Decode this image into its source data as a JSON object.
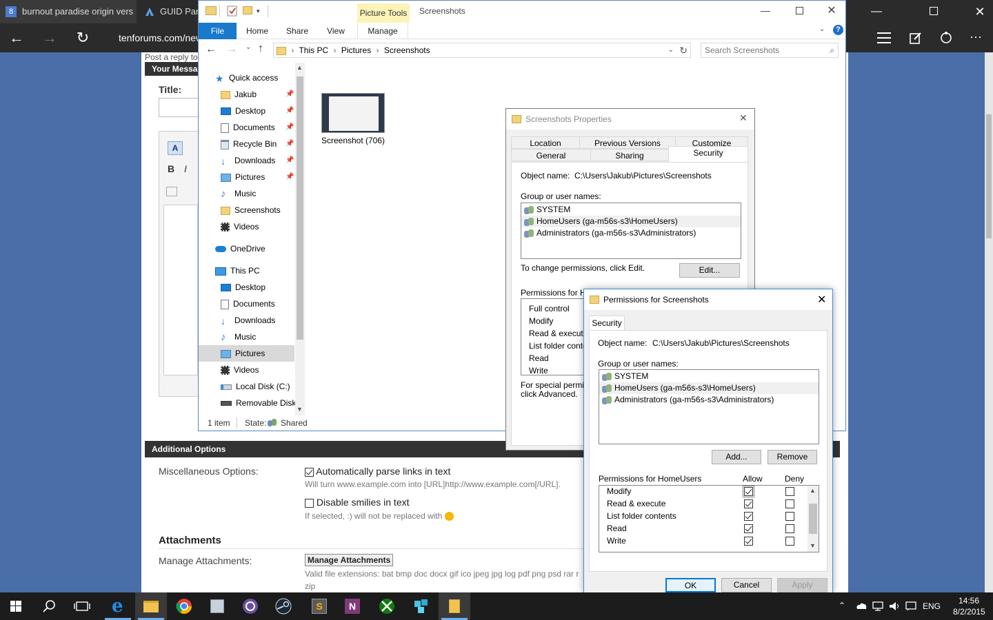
{
  "edge": {
    "tabs": [
      {
        "title": "burnout paradise origin vers"
      },
      {
        "title": "GUID Part"
      }
    ],
    "address": "tenforums.com/new"
  },
  "webpage": {
    "post_reply": "Post a reply to",
    "your_message": "Your Messag",
    "title_label": "Title:",
    "additional_options": "Additional Options",
    "misc_options_label": "Miscellaneous Options:",
    "auto_parse_label": "Automatically parse links in text",
    "auto_parse_hint": "Will turn www.example.com into [URL]http://www.example.com[/URL].",
    "disable_smilies_label": "Disable smilies in text",
    "disable_smilies_hint": "If selected, :) will not be replaced with",
    "attachments_heading": "Attachments",
    "manage_attachments_label": "Manage Attachments:",
    "manage_attachments_button": "Manage Attachments",
    "valid_extensions": "Valid file extensions: bat bmp doc docx gif ico jpeg jpg log pdf png psd rar r",
    "valid_extensions_tail": "zip"
  },
  "explorer": {
    "context_tab": "Picture Tools",
    "window_title": "Screenshots",
    "ribbon_tabs": [
      "File",
      "Home",
      "Share",
      "View",
      "Manage"
    ],
    "breadcrumb": [
      "This PC",
      "Pictures",
      "Screenshots"
    ],
    "search_placeholder": "Search Screenshots",
    "nav": [
      {
        "label": "Quick access",
        "icon": "star-icon",
        "pinned": false
      },
      {
        "label": "Jakub",
        "icon": "folder-icon",
        "pinned": true
      },
      {
        "label": "Desktop",
        "icon": "desktop-icon",
        "pinned": true
      },
      {
        "label": "Documents",
        "icon": "documents-icon",
        "pinned": true
      },
      {
        "label": "Recycle Bin",
        "icon": "recycle-bin-icon",
        "pinned": true
      },
      {
        "label": "Downloads",
        "icon": "downloads-icon",
        "pinned": true
      },
      {
        "label": "Pictures",
        "icon": "pictures-icon",
        "pinned": true
      },
      {
        "label": "Music",
        "icon": "music-icon",
        "pinned": false
      },
      {
        "label": "Screenshots",
        "icon": "folder-icon",
        "pinned": false
      },
      {
        "label": "Videos",
        "icon": "videos-icon",
        "pinned": false
      },
      {
        "label": "OneDrive",
        "icon": "onedrive-icon",
        "pinned": false
      },
      {
        "label": "This PC",
        "icon": "computer-icon",
        "pinned": false
      },
      {
        "label": "Desktop",
        "icon": "desktop-icon",
        "pinned": false
      },
      {
        "label": "Documents",
        "icon": "documents-icon",
        "pinned": false
      },
      {
        "label": "Downloads",
        "icon": "downloads-icon",
        "pinned": false
      },
      {
        "label": "Music",
        "icon": "music-icon",
        "pinned": false
      },
      {
        "label": "Pictures",
        "icon": "pictures-icon",
        "pinned": false
      },
      {
        "label": "Videos",
        "icon": "videos-icon",
        "pinned": false
      },
      {
        "label": "Local Disk (C:)",
        "icon": "local-disk-icon",
        "pinned": false
      },
      {
        "label": "Removable Disk",
        "icon": "removable-disk-icon",
        "pinned": false
      }
    ],
    "file": {
      "name": "Screenshot (706)"
    },
    "status_count": "1 item",
    "status_state_label": "State:",
    "status_state_value": "Shared"
  },
  "properties": {
    "title": "Screenshots Properties",
    "tabs_row1": [
      "Location",
      "Previous Versions",
      "Customize"
    ],
    "tabs_row2": [
      "General",
      "Sharing",
      "Security"
    ],
    "object_name_label": "Object name:",
    "object_name_value": "C:\\Users\\Jakub\\Pictures\\Screenshots",
    "group_label": "Group or user names:",
    "users": [
      "SYSTEM",
      "HomeUsers (ga-m56s-s3\\HomeUsers)",
      "Administrators (ga-m56s-s3\\Administrators)"
    ],
    "change_text": "To change permissions, click Edit.",
    "edit_button": "Edit...",
    "perms_label": "Permissions for Hom",
    "perms": [
      "Full control",
      "Modify",
      "Read & execute",
      "List folder conten",
      "Read",
      "Write"
    ],
    "special_text_1": "For special permissi",
    "special_text_2": "click Advanced."
  },
  "permissions": {
    "title": "Permissions for Screenshots",
    "tab": "Security",
    "object_name_label": "Object name:",
    "object_name_value": "C:\\Users\\Jakub\\Pictures\\Screenshots",
    "group_label": "Group or user names:",
    "users": [
      "SYSTEM",
      "HomeUsers (ga-m56s-s3\\HomeUsers)",
      "Administrators (ga-m56s-s3\\Administrators)"
    ],
    "add_button": "Add...",
    "remove_button": "Remove",
    "perms_label": "Permissions for HomeUsers",
    "allow_label": "Allow",
    "deny_label": "Deny",
    "perms": [
      {
        "name": "Modify",
        "allow": true,
        "deny": false
      },
      {
        "name": "Read & execute",
        "allow": true,
        "deny": false
      },
      {
        "name": "List folder contents",
        "allow": true,
        "deny": false
      },
      {
        "name": "Read",
        "allow": true,
        "deny": false
      },
      {
        "name": "Write",
        "allow": true,
        "deny": false
      }
    ],
    "ok_button": "OK",
    "cancel_button": "Cancel",
    "apply_button": "Apply"
  },
  "taskbar": {
    "language": "ENG",
    "time": "14:56",
    "date": "8/2/2015"
  }
}
